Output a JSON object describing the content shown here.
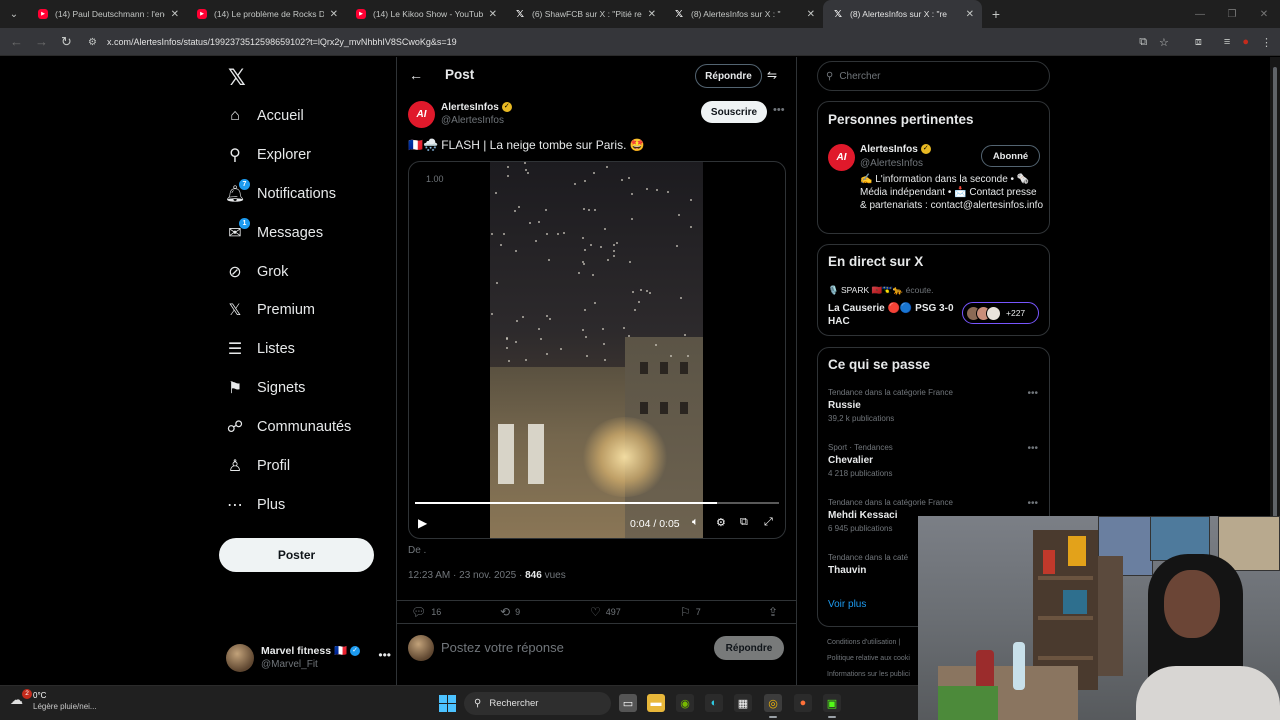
{
  "browser": {
    "tabs": [
      {
        "title": "(14) Paul Deutschmann : l'enquê",
        "icon": "youtube-icon",
        "active": false
      },
      {
        "title": "(14) Le problème de Rocks D. X",
        "icon": "youtube-icon",
        "active": false
      },
      {
        "title": "(14) Le Kikoo Show - YouTube",
        "icon": "youtube-icon",
        "active": false
      },
      {
        "title": "(6) ShawFCB sur X : \"Pitié regar",
        "icon": "x-icon",
        "active": false
      },
      {
        "title": "(8) AlertesInfos sur X : \"",
        "icon": "x-icon",
        "active": false
      },
      {
        "title": "(8) AlertesInfos sur X : \"re",
        "icon": "x-icon",
        "active": true
      }
    ],
    "url": "x.com/AlertesInfos/status/1992373512598659102?t=lQrx2y_mvNhbhIV8SCwoKg&s=19"
  },
  "sidebar": {
    "logo": "𝕏",
    "items": [
      {
        "label": "Accueil",
        "icon": "home-icon",
        "glyph": "⌂"
      },
      {
        "label": "Explorer",
        "icon": "search-icon",
        "glyph": "⚲"
      },
      {
        "label": "Notifications",
        "icon": "bell-icon",
        "glyph": "🔔︎",
        "badge": "7"
      },
      {
        "label": "Messages",
        "icon": "mail-icon",
        "glyph": "✉",
        "badge": "1"
      },
      {
        "label": "Grok",
        "icon": "grok-icon",
        "glyph": "⊘"
      },
      {
        "label": "Premium",
        "icon": "x-logo-icon",
        "glyph": "𝕏"
      },
      {
        "label": "Listes",
        "icon": "list-icon",
        "glyph": "☰"
      },
      {
        "label": "Signets",
        "icon": "bookmark-icon",
        "glyph": "⚑"
      },
      {
        "label": "Communautés",
        "icon": "communities-icon",
        "glyph": "☍"
      },
      {
        "label": "Profil",
        "icon": "profile-icon",
        "glyph": "♙"
      },
      {
        "label": "Plus",
        "icon": "more-circle-icon",
        "glyph": "⋯"
      }
    ],
    "post_button": "Poster",
    "account": {
      "name": "Marvel fitness 🇫🇷",
      "handle": "@Marvel_Fit"
    }
  },
  "main": {
    "header_title": "Post",
    "reply_button": "Répondre",
    "author": {
      "name": "AlertesInfos",
      "handle": "@AlertesInfos",
      "avatar_text": "AI"
    },
    "subscribe_button": "Souscrire",
    "tweet_text": "🇫🇷🌨️ FLASH | La neige tombe sur Paris. 🤩",
    "video": {
      "speed": "1.00",
      "time": "0:04 / 0:05",
      "progress": 0.83
    },
    "translation_line": "De .",
    "timestamp": "12:23 AM · 23 nov. 2025 · ",
    "views_count": "846",
    "views_label": " vues",
    "actions": {
      "replies": "16",
      "reposts": "9",
      "likes": "497",
      "bookmarks": "7"
    },
    "reply_placeholder": "Postez votre réponse",
    "reply_submit": "Répondre"
  },
  "right": {
    "search_placeholder": "Chercher",
    "relevant_title": "Personnes pertinentes",
    "relevant": {
      "name": "AlertesInfos",
      "handle": "@AlertesInfos",
      "follow_label": "Abonné",
      "bio": "✍️ L'information dans la seconde • 🗞️ Média indépendant • 📩 Contact presse & partenariats : contact@alertesinfos.info"
    },
    "live_title": "En direct sur X",
    "live": {
      "host": "🎙️ SPARK 🇲🇦🇬🇵🐆",
      "host_suffix": " écoute.",
      "title": "La Causerie 🔴🔵 PSG 3-0 HAC",
      "listeners": "+227"
    },
    "trends_title": "Ce qui se passe",
    "trends": [
      {
        "category": "Tendance dans la catégorie France",
        "name": "Russie",
        "count": "39,2 k publications"
      },
      {
        "category": "Sport · Tendances",
        "name": "Chevalier",
        "count": "4 218 publications"
      },
      {
        "category": "Tendance dans la catégorie France",
        "name": "Mehdi Kessaci",
        "count": "6 945 publications"
      },
      {
        "category": "Tendance dans la caté",
        "name": "Thauvin",
        "count": ""
      }
    ],
    "see_more": "Voir plus",
    "footer": [
      "Conditions d'utilisation |",
      "Politique relative aux cooki",
      "Informations sur les publici"
    ]
  },
  "taskbar": {
    "temperature": "0°C",
    "weather_desc": "Légère pluie/nei...",
    "weather_badge": "2",
    "search_label": "Rechercher"
  },
  "colors": {
    "accent": "#1d9bf0",
    "verified_gold": "#e8b923",
    "alertes_red": "#e0192b"
  }
}
